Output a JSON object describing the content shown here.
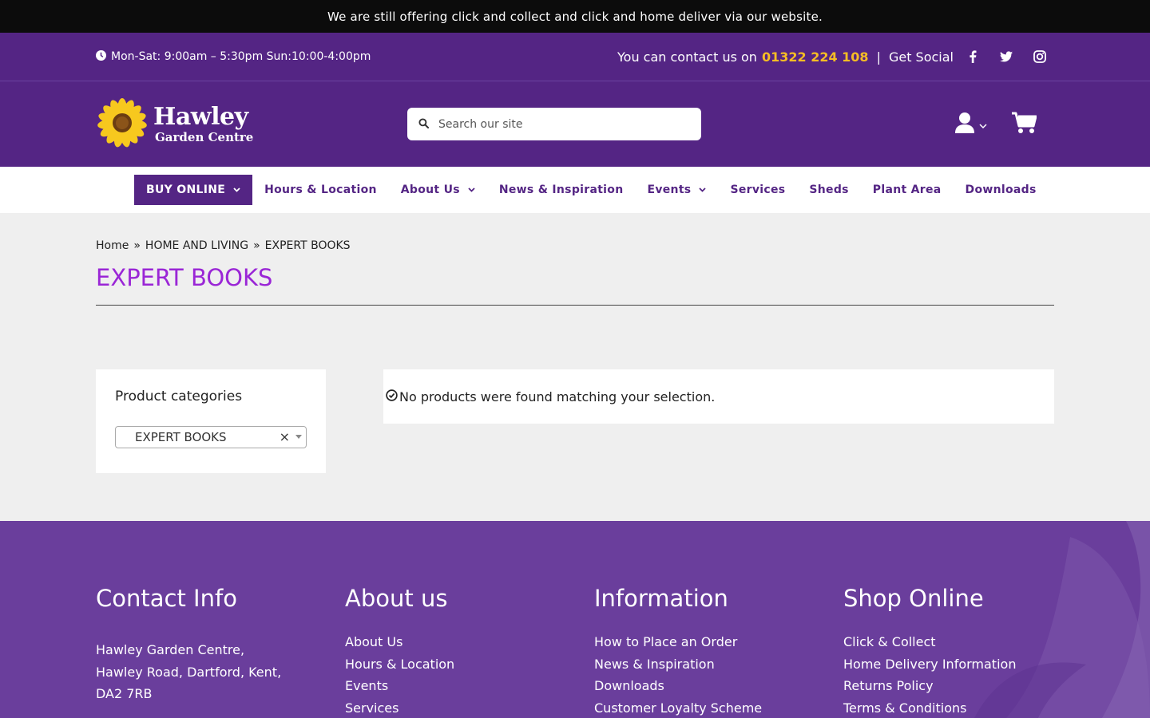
{
  "announcement": "We are still offering click and collect and click and home deliver via our website.",
  "infobar": {
    "hours": "Mon-Sat: 9:00am – 5:30pm Sun:10:00-4:00pm",
    "contact_text": "You can contact us on",
    "phone": "01322 224 108",
    "separator": "|",
    "social_label": "Get Social",
    "social_icons": [
      "facebook-icon",
      "twitter-icon",
      "instagram-icon"
    ]
  },
  "logo": {
    "title": "Hawley",
    "subtitle": "Garden Centre"
  },
  "search": {
    "placeholder": "Search our site"
  },
  "nav": {
    "items": [
      {
        "label": "BUY ONLINE",
        "dropdown": true
      },
      {
        "label": "Hours & Location",
        "dropdown": false
      },
      {
        "label": "About Us",
        "dropdown": true
      },
      {
        "label": "News & Inspiration",
        "dropdown": false
      },
      {
        "label": "Events",
        "dropdown": true
      },
      {
        "label": "Services",
        "dropdown": false
      },
      {
        "label": "Sheds",
        "dropdown": false
      },
      {
        "label": "Plant Area",
        "dropdown": false
      },
      {
        "label": "Downloads",
        "dropdown": false
      }
    ]
  },
  "breadcrumb": {
    "home": "Home",
    "sep": "»",
    "parent": "HOME AND LIVING",
    "current": "EXPERT BOOKS"
  },
  "page": {
    "title": "EXPERT BOOKS"
  },
  "sidebar": {
    "title": "Product categories",
    "selected": "EXPERT BOOKS",
    "clear": "×"
  },
  "notice": {
    "text": "No products were found matching your selection."
  },
  "footer": {
    "contact": {
      "heading": "Contact Info",
      "address_lines": [
        "Hawley Garden Centre,",
        "Hawley Road, Dartford, Kent,",
        "DA2 7RB"
      ]
    },
    "about": {
      "heading": "About us",
      "links": [
        "About Us",
        "Hours & Location",
        "Events",
        "Services"
      ]
    },
    "information": {
      "heading": "Information",
      "links": [
        "How to Place an Order",
        "News & Inspiration",
        "Downloads",
        "Customer Loyalty Scheme"
      ]
    },
    "shop": {
      "heading": "Shop Online",
      "links": [
        "Click & Collect",
        "Home Delivery Information",
        "Returns Policy",
        "Terms & Conditions"
      ]
    }
  },
  "colors": {
    "brand_purple": "#542584",
    "title_purple": "#9a26d6",
    "phone_gold": "#f6bd24",
    "footer_purple": "#6a3e9c"
  }
}
